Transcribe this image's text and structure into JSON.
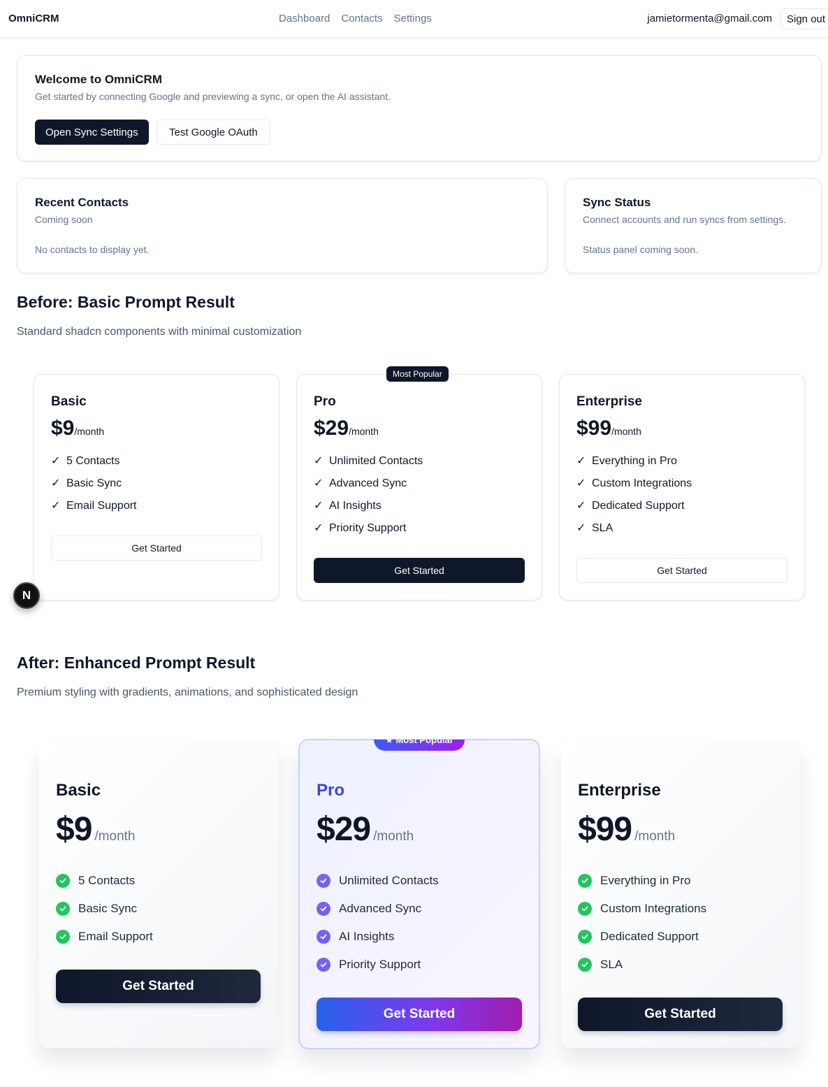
{
  "nav": {
    "brand": "OmniCRM",
    "links": [
      "Dashboard",
      "Contacts",
      "Settings"
    ],
    "user_email": "jamietormenta@gmail.com",
    "signout_label": "Sign out"
  },
  "welcome": {
    "title": "Welcome to OmniCRM",
    "subtitle": "Get started by connecting Google and previewing a sync, or open the AI assistant.",
    "primary_button": "Open Sync Settings",
    "secondary_button": "Test Google OAuth"
  },
  "recent_contacts": {
    "title": "Recent Contacts",
    "subtitle": "Coming soon",
    "empty_text": "No contacts to display yet."
  },
  "sync_status": {
    "title": "Sync Status",
    "subtitle": "Connect accounts and run syncs from settings.",
    "body": "Status panel coming soon."
  },
  "before": {
    "title": "Before: Basic Prompt Result",
    "subtitle": "Standard shadcn components with minimal customization",
    "badge": "Most Popular",
    "check_glyph": "✓",
    "plans": [
      {
        "name": "Basic",
        "price": "$9",
        "period": "/month",
        "features": [
          "5 Contacts",
          "Basic Sync",
          "Email Support"
        ],
        "button": "Get Started"
      },
      {
        "name": "Pro",
        "price": "$29",
        "period": "/month",
        "features": [
          "Unlimited Contacts",
          "Advanced Sync",
          "AI Insights",
          "Priority Support"
        ],
        "button": "Get Started"
      },
      {
        "name": "Enterprise",
        "price": "$99",
        "period": "/month",
        "features": [
          "Everything in Pro",
          "Custom Integrations",
          "Dedicated Support",
          "SLA"
        ],
        "button": "Get Started"
      }
    ]
  },
  "after": {
    "title": "After: Enhanced Prompt Result",
    "subtitle": "Premium styling with gradients, animations, and sophisticated design",
    "badge": "Most Popular",
    "plans": [
      {
        "name": "Basic",
        "price": "$9",
        "period": "/month",
        "features": [
          "5 Contacts",
          "Basic Sync",
          "Email Support"
        ],
        "button": "Get Started"
      },
      {
        "name": "Pro",
        "price": "$29",
        "period": "/month",
        "features": [
          "Unlimited Contacts",
          "Advanced Sync",
          "AI Insights",
          "Priority Support"
        ],
        "button": "Get Started"
      },
      {
        "name": "Enterprise",
        "price": "$99",
        "period": "/month",
        "features": [
          "Everything in Pro",
          "Custom Integrations",
          "Dedicated Support",
          "SLA"
        ],
        "button": "Get Started"
      }
    ]
  },
  "dev_badge": "N",
  "colors": {
    "primary_dark": "#0f172a",
    "muted_text": "#64748b",
    "check_green": "#22c55e",
    "pro_accent": "#3b47d8",
    "gradient_start": "#2563eb",
    "gradient_end": "#a21caf"
  }
}
